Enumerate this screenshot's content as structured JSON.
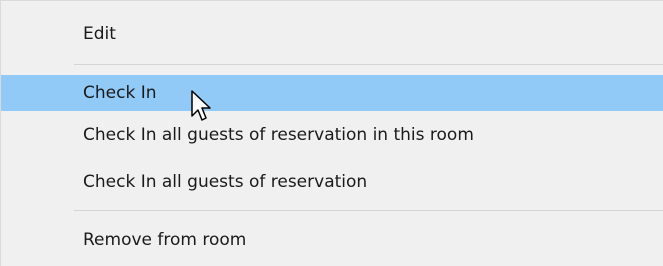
{
  "context_menu": {
    "items": [
      {
        "label": "Edit"
      },
      {
        "label": "Check In",
        "highlighted": true
      },
      {
        "label": "Check In all guests of reservation in this room"
      },
      {
        "label": "Check In all guests of reservation"
      },
      {
        "label": "Remove from room"
      }
    ]
  },
  "colors": {
    "menu_background": "#f0f0f0",
    "highlight": "#91c9f7",
    "separator": "#d5d5d5",
    "text": "#1a1a1a"
  },
  "icons": [
    "mouse-pointer-icon"
  ]
}
